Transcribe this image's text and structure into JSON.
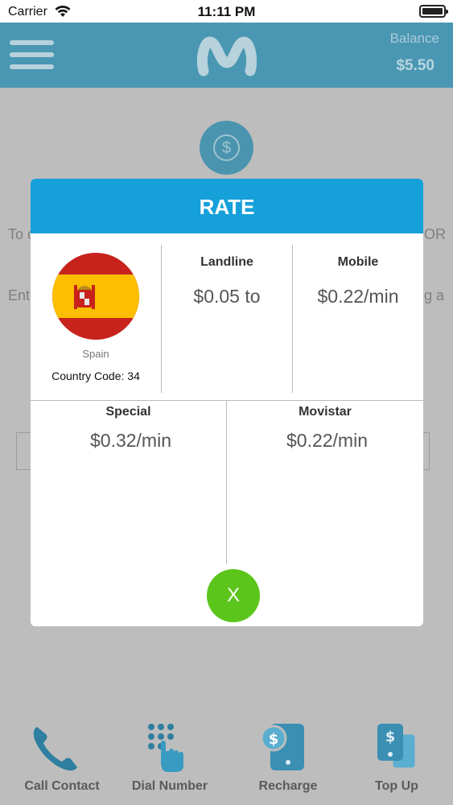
{
  "status_bar": {
    "carrier": "Carrier",
    "time": "11:11 PM"
  },
  "header": {
    "balance_label": "Balance",
    "balance_value": "$5.50",
    "accent_color": "#4a97b3"
  },
  "background": {
    "line1_left": "To c",
    "line1_right": "OR",
    "line2_left": "Ent",
    "line2_right": "g a"
  },
  "modal": {
    "title": "RATE",
    "country": {
      "name": "Spain",
      "code": "Country Code: 34"
    },
    "rates": {
      "landline": {
        "label": "Landline",
        "value": "$0.05 to"
      },
      "mobile": {
        "label": "Mobile",
        "value": "$0.22/min"
      },
      "special": {
        "label": "Special",
        "value": "$0.32/min"
      },
      "movistar": {
        "label": "Movistar",
        "value": "$0.22/min"
      }
    },
    "close_label": "X",
    "header_color": "#16a0d9",
    "close_color": "#5cc51c"
  },
  "tabbar": {
    "items": [
      {
        "label": "Call Contact",
        "icon": "phone-icon"
      },
      {
        "label": "Dial Number",
        "icon": "keypad-hand-icon"
      },
      {
        "label": "Recharge",
        "icon": "recharge-phone-icon"
      },
      {
        "label": "Top Up",
        "icon": "topup-cards-icon"
      }
    ]
  }
}
